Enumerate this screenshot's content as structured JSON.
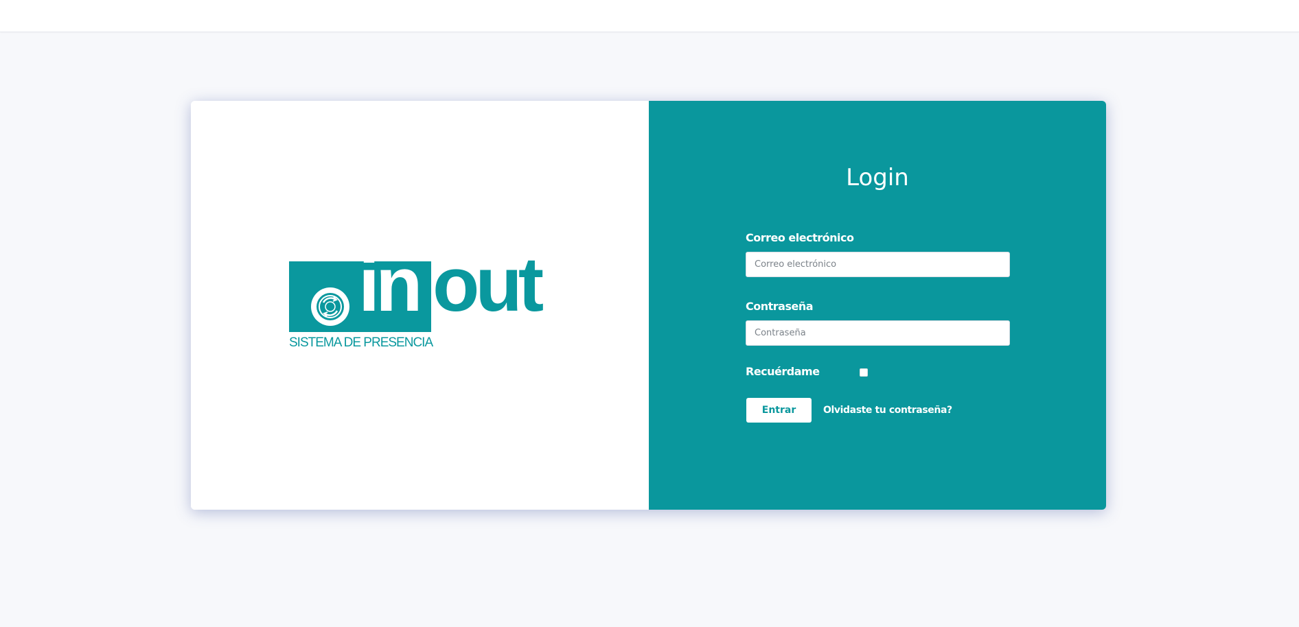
{
  "brand": {
    "logo_in": "in",
    "logo_out": "out",
    "logo_subtitle": "SISTEMA DE PRESENCIA",
    "accent_color": "#0a979d"
  },
  "login": {
    "title": "Login",
    "email_label": "Correo electrónico",
    "email_placeholder": "Correo electrónico",
    "email_value": "",
    "password_label": "Contraseña",
    "password_placeholder": "Contraseña",
    "password_value": "",
    "remember_label": "Recuérdame",
    "remember_checked": false,
    "submit_label": "Entrar",
    "forgot_label": "Olvidaste tu contraseña?"
  }
}
